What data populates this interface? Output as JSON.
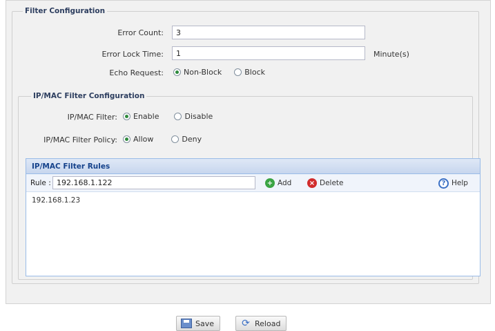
{
  "filter": {
    "title": "Filter Configuration",
    "error_count_label": "Error Count:",
    "error_count_value": "3",
    "error_lock_label": "Error Lock Time:",
    "error_lock_value": "1",
    "error_lock_unit": "Minute(s)",
    "echo_label": "Echo Request:",
    "echo_options": [
      "Non-Block",
      "Block"
    ],
    "echo_selected": "Non-Block"
  },
  "ipmac": {
    "title": "IP/MAC Filter Configuration",
    "filter_label": "IP/MAC Filter:",
    "filter_options": [
      "Enable",
      "Disable"
    ],
    "filter_selected": "Enable",
    "policy_label": "IP/MAC Filter Policy:",
    "policy_options": [
      "Allow",
      "Deny"
    ],
    "policy_selected": "Allow"
  },
  "rules": {
    "title": "IP/MAC Filter Rules",
    "rule_label": "Rule :",
    "rule_value": "192.168.1.122",
    "add_label": "Add",
    "delete_label": "Delete",
    "help_label": "Help",
    "items": [
      "192.168.1.23"
    ]
  },
  "footer": {
    "save_label": "Save",
    "reload_label": "Reload"
  },
  "icons": {
    "add": "plus-circle-icon",
    "delete": "x-circle-icon",
    "help": "question-circle-icon",
    "save": "floppy-disk-icon",
    "reload": "refresh-icon"
  },
  "colors": {
    "grid_header_text": "#15428b",
    "legend_text": "#2d3e5f",
    "add_green": "#3aa443",
    "delete_red": "#d12c2c",
    "help_blue": "#3a6fc4"
  }
}
